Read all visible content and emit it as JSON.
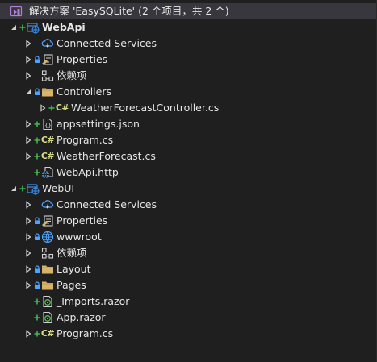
{
  "solution_explorer": {
    "solution_label": "解决方案 'EasySQLite' (2 个项目，共 2 个)",
    "rows": [
      {
        "name": "project-webapi",
        "label": "WebApi",
        "bold": true,
        "level": 0,
        "chevron": "expanded",
        "marks": [
          "plus"
        ],
        "icon": "web-project-icon"
      },
      {
        "name": "connected-services",
        "label": "Connected Services",
        "level": 1,
        "chevron": "collapsed",
        "marks": [],
        "icon": "connected-services-icon"
      },
      {
        "name": "properties",
        "label": "Properties",
        "level": 1,
        "chevron": "collapsed",
        "marks": [
          "lock"
        ],
        "icon": "properties-icon"
      },
      {
        "name": "dependencies",
        "label": "依赖项",
        "level": 1,
        "chevron": "collapsed",
        "marks": [],
        "icon": "dependencies-icon"
      },
      {
        "name": "folder-controllers",
        "label": "Controllers",
        "level": 1,
        "chevron": "expanded",
        "marks": [
          "lock"
        ],
        "icon": "folder-icon"
      },
      {
        "name": "file-weatherforecastcontroller",
        "label": "WeatherForecastController.cs",
        "level": 2,
        "chevron": "collapsed",
        "marks": [
          "plus"
        ],
        "icon": "csharp-file-icon"
      },
      {
        "name": "file-appsettings",
        "label": "appsettings.json",
        "level": 1,
        "chevron": "collapsed",
        "marks": [
          "plus"
        ],
        "icon": "json-file-icon"
      },
      {
        "name": "file-program-webapi",
        "label": "Program.cs",
        "level": 1,
        "chevron": "collapsed",
        "marks": [
          "plus"
        ],
        "icon": "csharp-file-icon"
      },
      {
        "name": "file-weatherforecast",
        "label": "WeatherForecast.cs",
        "level": 1,
        "chevron": "collapsed",
        "marks": [
          "plus"
        ],
        "icon": "csharp-file-icon"
      },
      {
        "name": "file-webapi-http",
        "label": "WebApi.http",
        "level": 1,
        "chevron": "none",
        "marks": [
          "plus"
        ],
        "icon": "http-file-icon"
      },
      {
        "name": "project-webui",
        "label": "WebUI",
        "level": 0,
        "chevron": "expanded",
        "marks": [
          "plus"
        ],
        "icon": "web-project-icon"
      },
      {
        "name": "connected-services-ui",
        "label": "Connected Services",
        "level": 1,
        "chevron": "collapsed",
        "marks": [],
        "icon": "connected-services-icon"
      },
      {
        "name": "properties-ui",
        "label": "Properties",
        "level": 1,
        "chevron": "collapsed",
        "marks": [
          "lock"
        ],
        "icon": "properties-icon"
      },
      {
        "name": "folder-wwwroot",
        "label": "wwwroot",
        "level": 1,
        "chevron": "collapsed",
        "marks": [
          "lock"
        ],
        "icon": "globe-icon"
      },
      {
        "name": "dependencies-ui",
        "label": "依赖项",
        "level": 1,
        "chevron": "collapsed",
        "marks": [],
        "icon": "dependencies-icon"
      },
      {
        "name": "folder-layout",
        "label": "Layout",
        "level": 1,
        "chevron": "collapsed",
        "marks": [
          "lock"
        ],
        "icon": "folder-icon"
      },
      {
        "name": "folder-pages",
        "label": "Pages",
        "level": 1,
        "chevron": "collapsed",
        "marks": [
          "lock"
        ],
        "icon": "folder-icon"
      },
      {
        "name": "file-imports-razor",
        "label": "_Imports.razor",
        "level": 1,
        "chevron": "none",
        "marks": [
          "plus"
        ],
        "icon": "razor-file-icon"
      },
      {
        "name": "file-app-razor",
        "label": "App.razor",
        "level": 1,
        "chevron": "none",
        "marks": [
          "plus"
        ],
        "icon": "razor-file-icon"
      },
      {
        "name": "file-program-webui",
        "label": "Program.cs",
        "level": 1,
        "chevron": "collapsed",
        "marks": [
          "plus"
        ],
        "icon": "csharp-file-icon"
      }
    ]
  },
  "colors": {
    "background": "#1f1f1f",
    "selected": "#37373d",
    "text": "#e6e6e6",
    "plus_mark": "#3fb950",
    "lock_mark": "#4fa3ff",
    "folder": "#d8b46a",
    "csharp": "#d7dc8a",
    "project_blue": "#3b8eea",
    "razor_green": "#5fb35f"
  }
}
